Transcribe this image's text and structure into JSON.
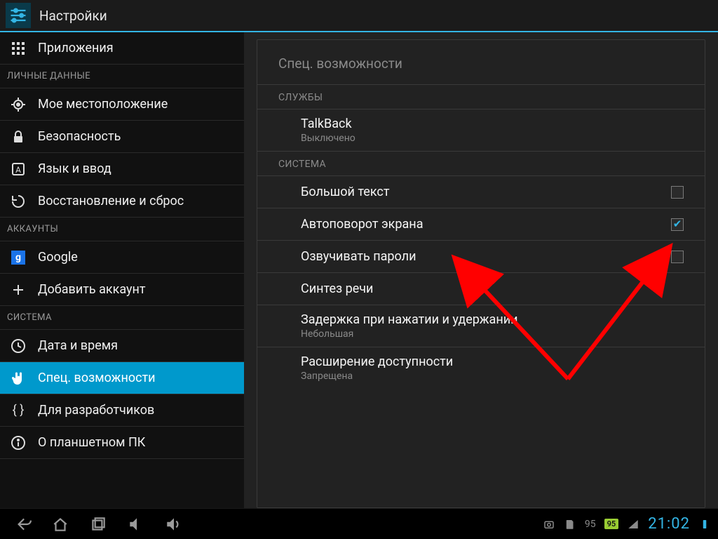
{
  "titlebar": {
    "title": "Настройки"
  },
  "sidebar": {
    "items": [
      {
        "kind": "item",
        "icon": "apps-icon",
        "label": "Приложения"
      },
      {
        "kind": "cat",
        "label": "ЛИЧНЫЕ ДАННЫЕ"
      },
      {
        "kind": "item",
        "icon": "location-icon",
        "label": "Мое местоположение"
      },
      {
        "kind": "item",
        "icon": "lock-icon",
        "label": "Безопасность"
      },
      {
        "kind": "item",
        "icon": "language-icon",
        "label": "Язык и ввод"
      },
      {
        "kind": "item",
        "icon": "backup-icon",
        "label": "Восстановление и сброс"
      },
      {
        "kind": "cat",
        "label": "АККАУНТЫ"
      },
      {
        "kind": "item",
        "icon": "google-icon",
        "label": "Google"
      },
      {
        "kind": "item",
        "icon": "plus-icon",
        "label": "Добавить аккаунт"
      },
      {
        "kind": "cat",
        "label": "СИСТЕМА"
      },
      {
        "kind": "item",
        "icon": "clock-icon",
        "label": "Дата и время"
      },
      {
        "kind": "item",
        "icon": "hand-icon",
        "label": "Спец. возможности",
        "selected": true
      },
      {
        "kind": "item",
        "icon": "braces-icon",
        "label": "Для разработчиков"
      },
      {
        "kind": "item",
        "icon": "info-icon",
        "label": "О планшетном ПК"
      }
    ]
  },
  "content": {
    "header": "Спец. возможности",
    "sections": [
      {
        "cat": "СЛУЖБЫ",
        "rows": [
          {
            "title": "TalkBack",
            "subtitle": "Выключено"
          }
        ]
      },
      {
        "cat": "СИСТЕМА",
        "rows": [
          {
            "title": "Большой текст",
            "checkbox": false
          },
          {
            "title": "Автоповорот экрана",
            "checkbox": true
          },
          {
            "title": "Озвучивать пароли",
            "checkbox": false
          },
          {
            "title": "Синтез речи"
          },
          {
            "title": "Задержка при нажатии и удержании",
            "subtitle": "Небольшая"
          },
          {
            "title": "Расширение доступности",
            "subtitle": "Запрещена"
          }
        ]
      }
    ]
  },
  "navbar": {
    "battery_text": "95",
    "battery_badge": "95",
    "clock": "21:02"
  }
}
